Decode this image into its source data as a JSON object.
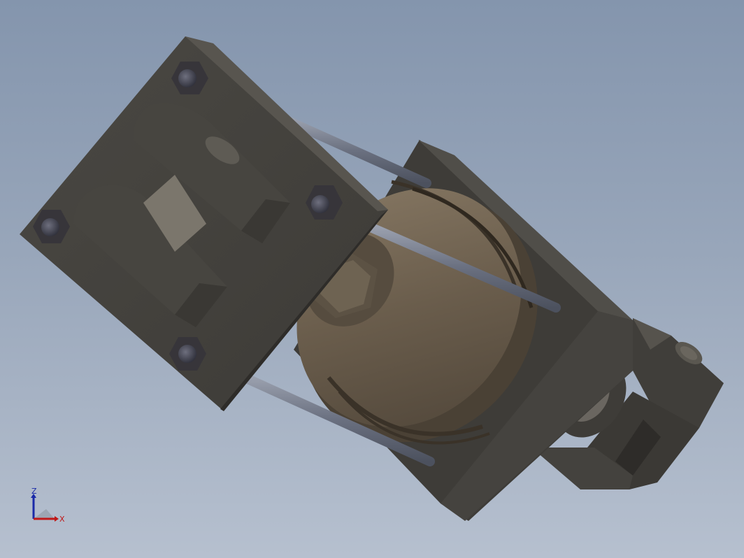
{
  "viewport": {
    "background_top": "#8495ad",
    "background_bottom": "#b6c0cf"
  },
  "model": {
    "body_color": "#47443f",
    "barrel_color": "#6e6252",
    "rod_color": "#6c7282"
  },
  "triad": {
    "z_label": "Z",
    "x_label": "X",
    "z_color": "#1a2aa8",
    "x_color": "#c01818"
  }
}
